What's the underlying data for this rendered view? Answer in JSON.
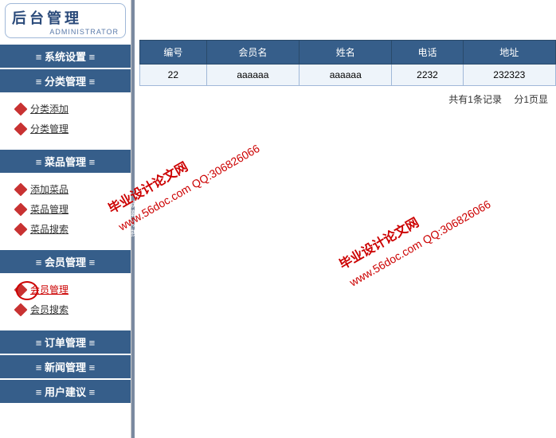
{
  "logo": {
    "cn": "后台管理",
    "en": "ADMINISTRATOR"
  },
  "sidebar": {
    "sections": [
      {
        "title": "系统设置",
        "items": []
      },
      {
        "title": "分类管理",
        "items": [
          {
            "label": "分类添加",
            "active": false
          },
          {
            "label": "分类管理",
            "active": false
          }
        ]
      },
      {
        "title": "菜品管理",
        "items": [
          {
            "label": "添加菜品",
            "active": false
          },
          {
            "label": "菜品管理",
            "active": false
          },
          {
            "label": "菜品搜索",
            "active": false
          }
        ]
      },
      {
        "title": "会员管理",
        "items": [
          {
            "label": "会员管理",
            "active": true
          },
          {
            "label": "会员搜索",
            "active": false
          }
        ]
      },
      {
        "title": "订单管理",
        "items": []
      },
      {
        "title": "新闻管理",
        "items": []
      },
      {
        "title": "用户建议",
        "items": []
      }
    ]
  },
  "table": {
    "headers": [
      "编号",
      "会员名",
      "姓名",
      "电话",
      "地址"
    ],
    "rows": [
      [
        "22",
        "aaaaaa",
        "aaaaaa",
        "2232",
        "232323"
      ]
    ]
  },
  "pagination": {
    "total": "共有1条记录",
    "pages": "分1页显"
  },
  "divider": "屏幕切换",
  "watermark": {
    "line1": "毕业设计论文网",
    "line2": "www.56doc.com  QQ:306826066"
  }
}
